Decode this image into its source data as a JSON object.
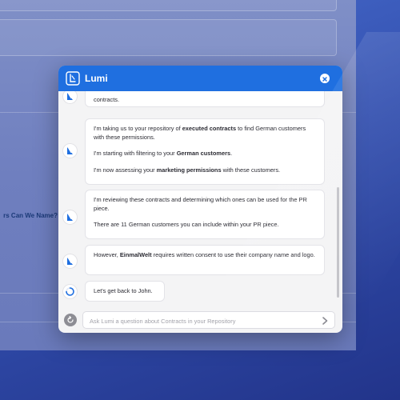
{
  "chat": {
    "title": "Lumi",
    "input_placeholder": "Ask Lumi a question about Contracts in your Repository"
  },
  "background": {
    "question_partial": "rs Can We Name?"
  },
  "messages": [
    {
      "sender": "assistant",
      "status": "done",
      "paragraphs": [
        [
          {
            "t": "contracts."
          }
        ]
      ]
    },
    {
      "sender": "assistant",
      "status": "done",
      "paragraphs": [
        [
          {
            "t": "I'm taking us to your repository of "
          },
          {
            "t": "executed contracts",
            "b": true
          },
          {
            "t": " to find German customers with these permissions."
          }
        ],
        [
          {
            "t": "I'm starting with filtering to your "
          },
          {
            "t": "German customers",
            "b": true
          },
          {
            "t": "."
          }
        ],
        [
          {
            "t": "I'm now assessing your "
          },
          {
            "t": "marketing permissions",
            "b": true
          },
          {
            "t": " with these customers."
          }
        ]
      ]
    },
    {
      "sender": "assistant",
      "status": "done",
      "paragraphs": [
        [
          {
            "t": "I'm reviewing these contracts and determining which ones can be used for the PR piece."
          }
        ],
        [
          {
            "t": "There are 11 German customers you can include within your PR piece."
          }
        ]
      ]
    },
    {
      "sender": "assistant",
      "status": "done",
      "paragraphs": [
        [
          {
            "t": "However, "
          },
          {
            "t": "EinmalWelt",
            "b": true
          },
          {
            "t": " requires written consent to use their company name and logo."
          }
        ]
      ]
    },
    {
      "sender": "assistant",
      "status": "loading",
      "paragraphs": [
        [
          {
            "t": "Let's get back to John."
          }
        ]
      ]
    }
  ],
  "icons": {
    "logo": "lumi-logo-icon",
    "close": "close-icon",
    "avatar": "lumi-avatar-icon",
    "loading": "loading-spinner-icon",
    "reset": "reset-icon",
    "send": "send-icon"
  },
  "colors": {
    "brand": "#1f6fe0",
    "chat_bg": "#f4f4f5",
    "bubble_bg": "#ffffff"
  }
}
